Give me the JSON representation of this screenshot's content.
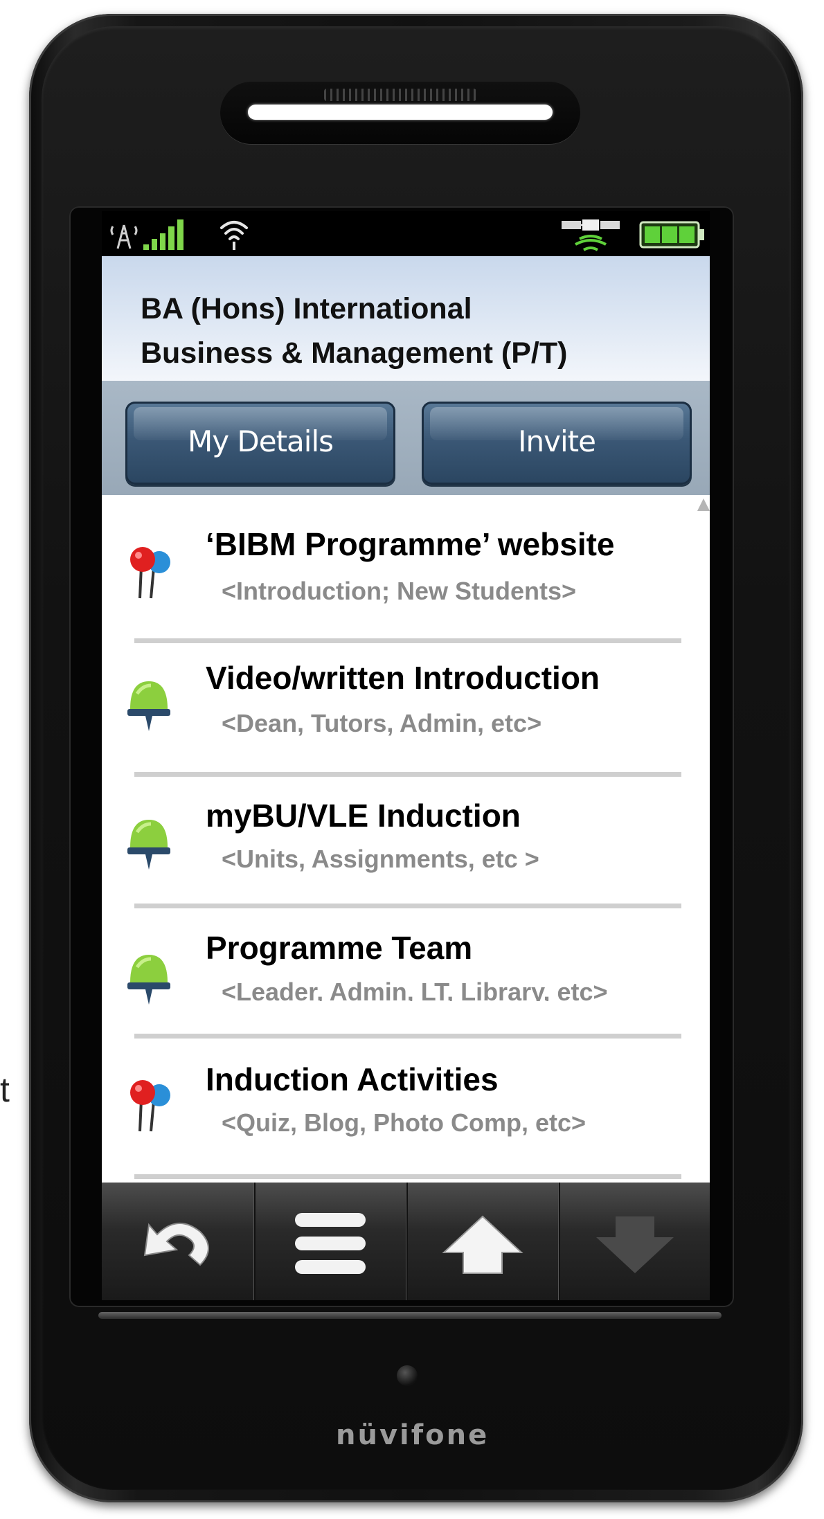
{
  "page": {
    "stray_text": "t"
  },
  "device": {
    "brand": "nüvifone"
  },
  "status_bar": {
    "icons": [
      "signal-strength-icon",
      "wifi-icon",
      "gps-satellite-icon",
      "battery-icon"
    ],
    "colors": {
      "signal": "#7fd64a",
      "battery": "#5fd13a"
    }
  },
  "header": {
    "title_line1": "BA (Hons) International",
    "title_line2": "Business & Management (P/T)"
  },
  "actions": {
    "my_details_label": "My Details",
    "invite_label": "Invite"
  },
  "list": {
    "items": [
      {
        "title": "‘BIBM Programme’ website",
        "subtitle": "<Introduction; New Students>",
        "icon": "red-blue-pins-icon"
      },
      {
        "title": "Video/written Introduction",
        "subtitle": "<Dean, Tutors, Admin, etc>",
        "icon": "green-pin-icon"
      },
      {
        "title": "myBU/VLE Induction",
        "subtitle": "<Units, Assignments, etc >",
        "icon": "green-pin-icon"
      },
      {
        "title": "Programme Team",
        "subtitle": "<Leader, Admin, LT, Library, etc>",
        "icon": "green-pin-icon"
      },
      {
        "title": "Induction Activities",
        "subtitle": "<Quiz, Blog, Photo Comp, etc>",
        "icon": "red-blue-pins-icon"
      }
    ]
  },
  "nav": {
    "buttons": [
      "back-icon",
      "menu-icon",
      "up-arrow-icon",
      "down-arrow-icon"
    ]
  },
  "colors": {
    "header_bg": "#dfe8f4",
    "button_bg": "#3b5876",
    "subtitle_text": "#8a8a8a",
    "divider": "#cfcfcf"
  }
}
